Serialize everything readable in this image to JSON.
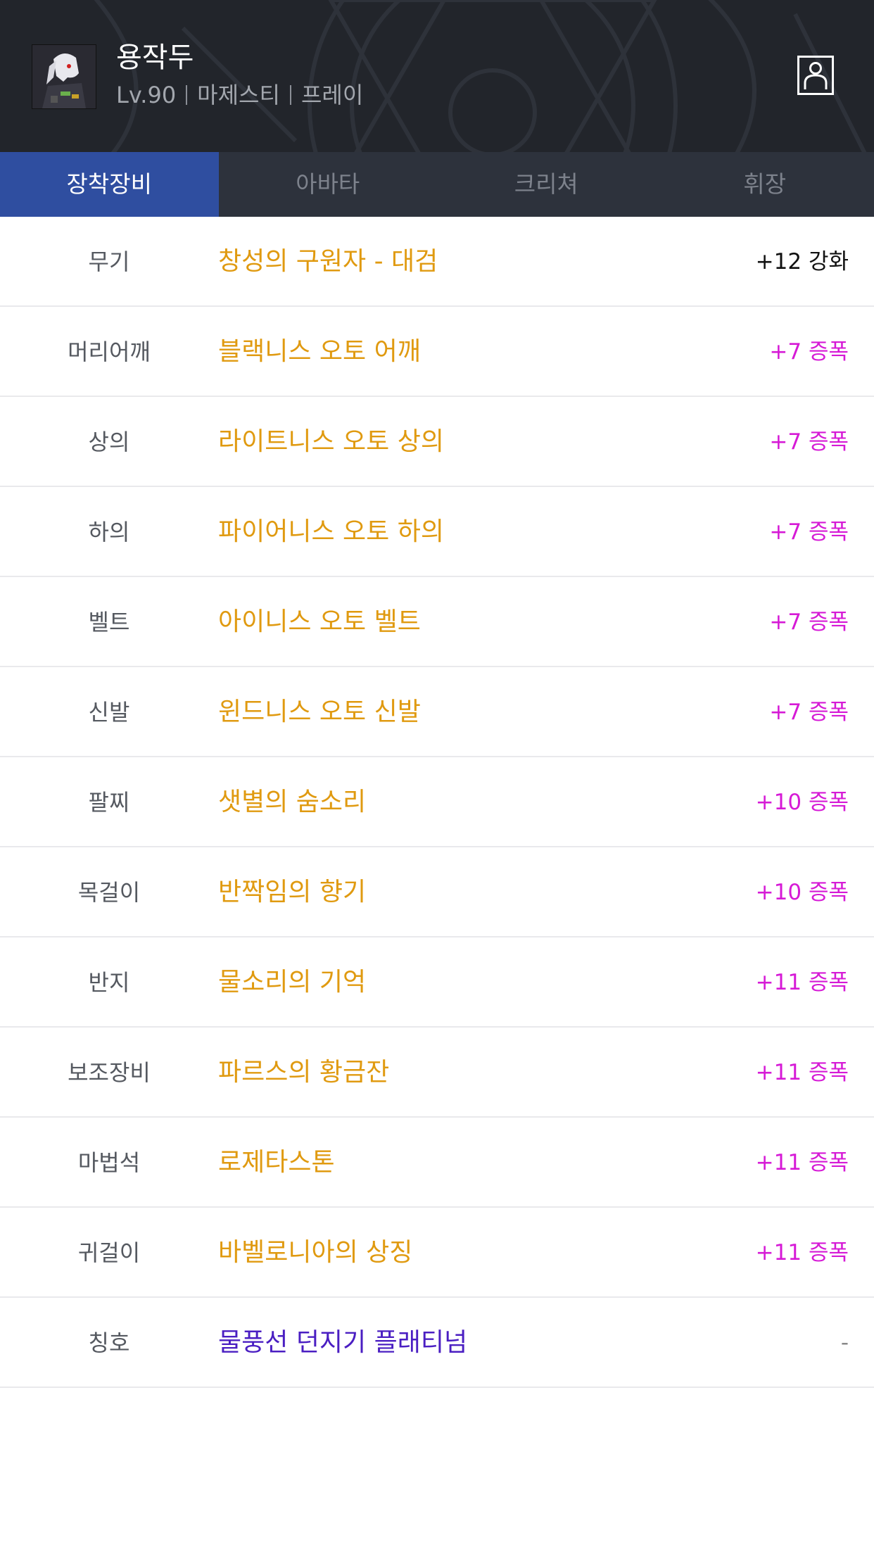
{
  "colors": {
    "header_bg": "#22252b",
    "tab_bar_bg": "#2d323c",
    "tab_active_bg": "#2f4ea0",
    "item_epic": "#e09a10",
    "item_legendary": "#4a1ec2",
    "enh_reinforce": "#111111",
    "enh_amplify": "#d61ad6",
    "enh_none": "#888888"
  },
  "header": {
    "avatar_icon": "character-portrait",
    "name": "용작두",
    "level": "Lv.90",
    "job": "마제스티",
    "server": "프레이",
    "profile_icon": "user-profile-icon"
  },
  "tabs": [
    {
      "label": "장착장비",
      "active": true
    },
    {
      "label": "아바타",
      "active": false
    },
    {
      "label": "크리쳐",
      "active": false
    },
    {
      "label": "휘장",
      "active": false
    }
  ],
  "equipment": [
    {
      "slot": "무기",
      "item": "창성의 구원자 - 대검",
      "enhance": "+12 강화",
      "item_color": "#e09a10",
      "enh_color": "#111111"
    },
    {
      "slot": "머리어깨",
      "item": "블랙니스 오토 어깨",
      "enhance": "+7 증폭",
      "item_color": "#e09a10",
      "enh_color": "#d61ad6"
    },
    {
      "slot": "상의",
      "item": "라이트니스 오토 상의",
      "enhance": "+7 증폭",
      "item_color": "#e09a10",
      "enh_color": "#d61ad6"
    },
    {
      "slot": "하의",
      "item": "파이어니스 오토 하의",
      "enhance": "+7 증폭",
      "item_color": "#e09a10",
      "enh_color": "#d61ad6"
    },
    {
      "slot": "벨트",
      "item": "아이니스 오토 벨트",
      "enhance": "+7 증폭",
      "item_color": "#e09a10",
      "enh_color": "#d61ad6"
    },
    {
      "slot": "신발",
      "item": "윈드니스 오토 신발",
      "enhance": "+7 증폭",
      "item_color": "#e09a10",
      "enh_color": "#d61ad6"
    },
    {
      "slot": "팔찌",
      "item": "샛별의 숨소리",
      "enhance": "+10 증폭",
      "item_color": "#e09a10",
      "enh_color": "#d61ad6"
    },
    {
      "slot": "목걸이",
      "item": "반짝임의 향기",
      "enhance": "+10 증폭",
      "item_color": "#e09a10",
      "enh_color": "#d61ad6"
    },
    {
      "slot": "반지",
      "item": "물소리의 기억",
      "enhance": "+11 증폭",
      "item_color": "#e09a10",
      "enh_color": "#d61ad6"
    },
    {
      "slot": "보조장비",
      "item": "파르스의 황금잔",
      "enhance": "+11 증폭",
      "item_color": "#e09a10",
      "enh_color": "#d61ad6"
    },
    {
      "slot": "마법석",
      "item": "로제타스톤",
      "enhance": "+11 증폭",
      "item_color": "#e09a10",
      "enh_color": "#d61ad6"
    },
    {
      "slot": "귀걸이",
      "item": "바벨로니아의 상징",
      "enhance": "+11 증폭",
      "item_color": "#e09a10",
      "enh_color": "#d61ad6"
    },
    {
      "slot": "칭호",
      "item": "물풍선 던지기 플래티넘",
      "enhance": "-",
      "item_color": "#4a1ec2",
      "enh_color": "#888888"
    }
  ]
}
